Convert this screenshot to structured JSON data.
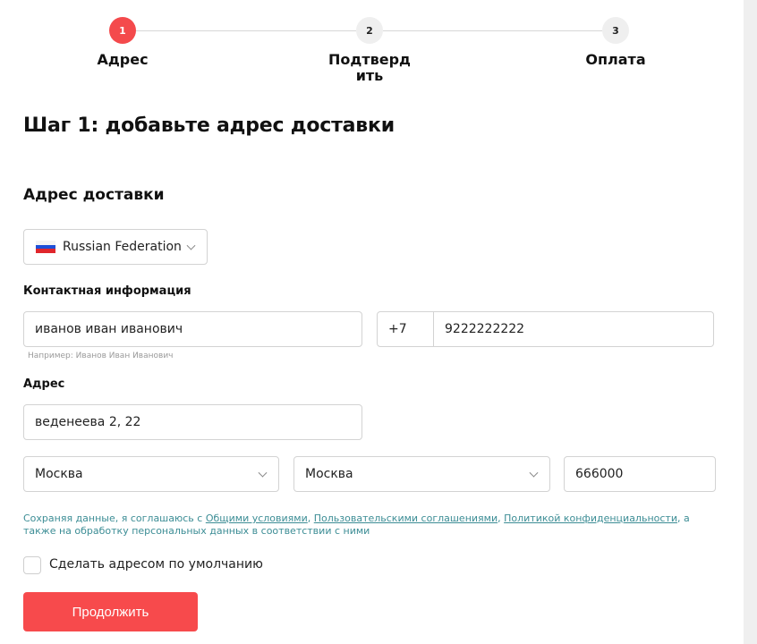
{
  "stepper": {
    "steps": [
      {
        "number": "1",
        "label": "Адрес",
        "state": "active"
      },
      {
        "number": "2",
        "label_line1": "Подтверд",
        "label_line2": "ить",
        "state": "inactive"
      },
      {
        "number": "3",
        "label": "Оплата",
        "state": "inactive"
      }
    ]
  },
  "page_title": "Шаг 1: добавьте адрес доставки",
  "section_title": "Адрес доставки",
  "country": {
    "value": "Russian Federation",
    "flag_icon": "russia-flag-icon"
  },
  "contact": {
    "label": "Контактная информация",
    "name_value": "иванов иван иванович",
    "name_hint": "Например: Иванов Иван Иванович",
    "phone_prefix": "+7",
    "phone_value": "9222222222"
  },
  "address": {
    "label": "Адрес",
    "street_value": "веденеева 2, 22",
    "region_value": "Москва",
    "city_value": "Москва",
    "postal_value": "666000"
  },
  "consent": {
    "prefix": "Сохраняя данные, я соглашаюсь с ",
    "link1": "Общими условиями",
    "sep1": ", ",
    "link2": "Пользовательскими соглашениями",
    "sep2": ", ",
    "link3": "Политикой конфиденциальности",
    "suffix": ", а также на обработку персональных данных в соответствии с ними"
  },
  "default_checkbox": {
    "label": "Сделать адресом по умолчанию",
    "checked": false
  },
  "continue_button": "Продолжить",
  "colors": {
    "accent": "#f74a4c",
    "link": "#3c8d95"
  }
}
